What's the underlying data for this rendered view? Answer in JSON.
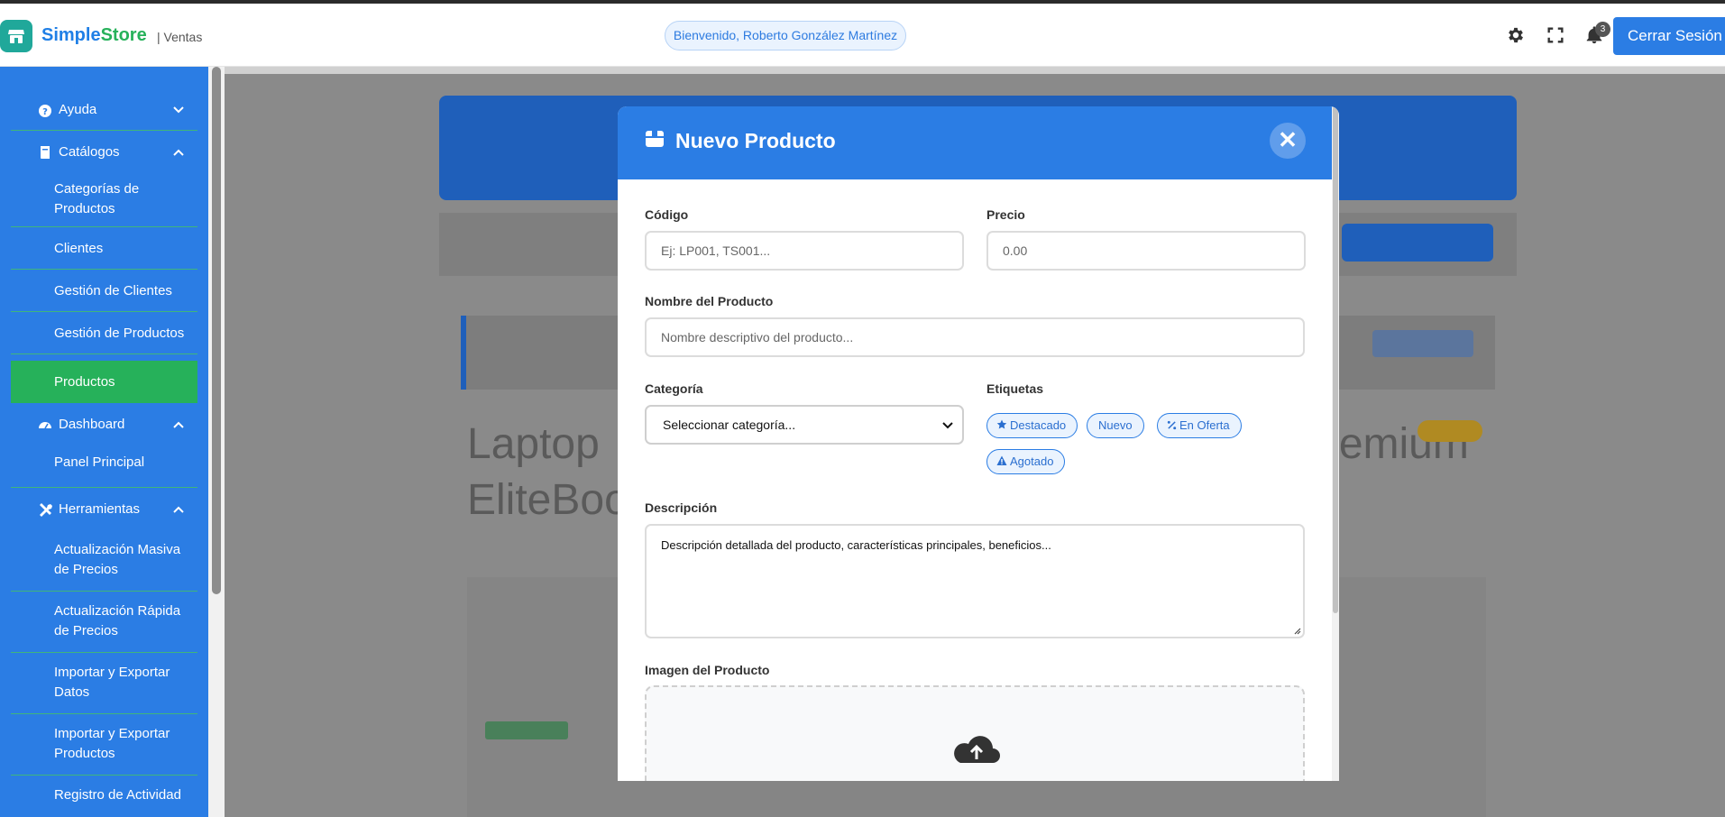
{
  "header": {
    "brand_simple": "Simple",
    "brand_store": "Store",
    "brand_sub": "| Ventas",
    "welcome": "Bienvenido, Roberto González Martínez",
    "notifications_count": "3",
    "logout_label": "Cerrar Sesión"
  },
  "sidebar": {
    "ayuda": "Ayuda",
    "catalogos": "Catálogos",
    "categorias_line1": "Categorías de",
    "categorias_line2": "Productos",
    "clientes": "Clientes",
    "gestion_clientes": "Gestión de Clientes",
    "gestion_productos": "Gestión de Productos",
    "productos": "Productos",
    "dashboard": "Dashboard",
    "panel_principal": "Panel Principal",
    "herramientas": "Herramientas",
    "act_masiva_line1": "Actualización Masiva",
    "act_masiva_line2": "de Precios",
    "act_rapida_line1": "Actualización Rápida",
    "act_rapida_line2": "de Precios",
    "imp_datos_line1": "Importar y Exportar",
    "imp_datos_line2": "Datos",
    "imp_prod_line1": "Importar y Exportar",
    "imp_prod_line2": "Productos",
    "registro": "Registro de Actividad"
  },
  "background": {
    "big_text_line1": "Laptop",
    "big_text_line1_right": "emium",
    "big_text_line2": "EliteBoo"
  },
  "modal": {
    "title": "Nuevo Producto",
    "close_symbol": "✕",
    "codigo_label": "Código",
    "codigo_placeholder": "Ej: LP001, TS001...",
    "precio_label": "Precio",
    "precio_placeholder": "0.00",
    "nombre_label": "Nombre del Producto",
    "nombre_placeholder": "Nombre descriptivo del producto...",
    "categoria_label": "Categoría",
    "categoria_selected": "Seleccionar categoría...",
    "etiquetas_label": "Etiquetas",
    "tags": {
      "destacado": "Destacado",
      "nuevo": "Nuevo",
      "en_oferta": "En Oferta",
      "agotado": "Agotado"
    },
    "descripcion_label": "Descripción",
    "descripcion_placeholder": "Descripción detallada del producto, características principales, beneficios...",
    "imagen_label": "Imagen del Producto"
  },
  "colors": {
    "primary": "#2b7de4",
    "accent_green": "#26b15a",
    "overlay": "#8a8a8a"
  }
}
